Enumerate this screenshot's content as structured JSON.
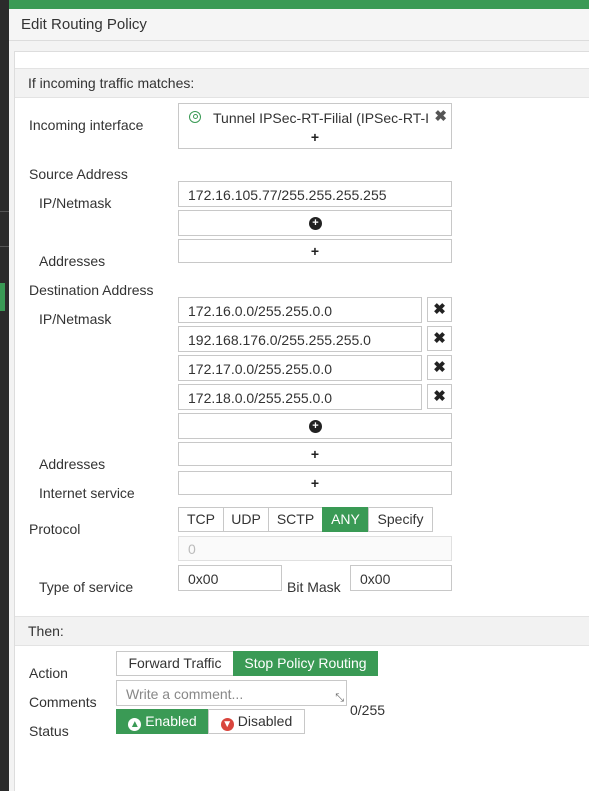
{
  "header": {
    "title": "Edit Routing Policy"
  },
  "match_section": {
    "title": "If incoming traffic matches:"
  },
  "incoming_interface": {
    "label": "Incoming interface",
    "value": "Tunnel IPSec-RT-Filial (IPSec-RT-I",
    "add": "+"
  },
  "source_address": {
    "label": "Source Address",
    "ipmask_label": "IP/Netmask",
    "ipmask_value": "172.16.105.77/255.255.255.255",
    "add_ipmask": "+",
    "addresses_label": "Addresses",
    "addresses_add": "+"
  },
  "destination_address": {
    "label": "Destination Address",
    "ipmask_label": "IP/Netmask",
    "ipmasks": [
      "172.16.0.0/255.255.0.0",
      "192.168.176.0/255.255.255.0",
      "172.17.0.0/255.255.0.0",
      "172.18.0.0/255.255.0.0"
    ],
    "remove_glyph": "✖",
    "add_ipmask": "+",
    "addresses_label": "Addresses",
    "addresses_add": "+",
    "internet_service_label": "Internet service",
    "internet_service_add": "+"
  },
  "protocol": {
    "label": "Protocol",
    "options": [
      "TCP",
      "UDP",
      "SCTP",
      "ANY",
      "Specify"
    ],
    "selected": "ANY",
    "number_placeholder": "0"
  },
  "tos": {
    "label": "Type of service",
    "value": "0x00",
    "bitmask_label": "Bit Mask",
    "bitmask_value": "0x00"
  },
  "then_section": {
    "title": "Then:"
  },
  "action": {
    "label": "Action",
    "options": [
      "Forward Traffic",
      "Stop Policy Routing"
    ],
    "selected": "Stop Policy Routing"
  },
  "comments": {
    "label": "Comments",
    "placeholder": "Write a comment...",
    "counter": "0/255"
  },
  "status": {
    "label": "Status",
    "enabled_label": "Enabled",
    "disabled_label": "Disabled",
    "selected": "Enabled"
  },
  "colors": {
    "accent": "#3a9a55",
    "disabled_icon": "#d9453d"
  }
}
